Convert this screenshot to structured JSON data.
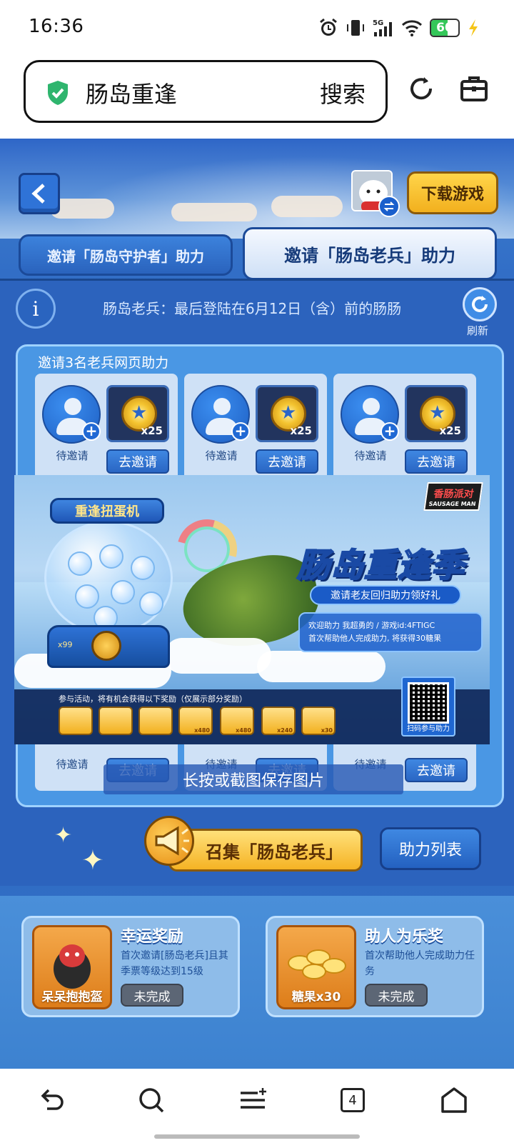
{
  "status_bar": {
    "time": "16:36",
    "battery_level": "60",
    "icons": [
      "alarm-icon",
      "vibrate-icon",
      "signal-5g-icon",
      "wifi-icon",
      "battery-icon",
      "charging-icon"
    ]
  },
  "browser": {
    "query": "肠岛重逢",
    "search_label": "搜索",
    "icons": [
      "shield-check-icon",
      "refresh-icon",
      "toolbox-icon"
    ]
  },
  "game": {
    "download_label": "下载游戏",
    "tabs": [
      {
        "label": "邀请「肠岛守护者」助力",
        "active": false
      },
      {
        "label": "邀请「肠岛老兵」助力",
        "active": true
      }
    ],
    "veteran_rule": "肠岛老兵：最后登陆在6月12日（含）前的肠肠",
    "refresh_label": "刷新",
    "invite_title": "邀请3名老兵网页助力",
    "invite_cards": [
      {
        "status": "待邀请",
        "reward_qty": "x25",
        "button": "去邀请"
      },
      {
        "status": "待邀请",
        "reward_qty": "x25",
        "button": "去邀请"
      },
      {
        "status": "待邀请",
        "reward_qty": "x25",
        "button": "去邀请"
      }
    ],
    "invite_cards_lower": [
      {
        "status": "待邀请",
        "button": "去邀请"
      },
      {
        "status": "待邀请",
        "button": "去邀请"
      },
      {
        "status": "待邀请",
        "button": "去邀请"
      }
    ],
    "gather_label": "召集「肠岛老兵」",
    "help_list_label": "助力列表",
    "awards": [
      {
        "title": "幸运奖励",
        "desc": "首次邀请[肠岛老兵]且其季票等级达到15级",
        "item": "呆呆抱抱盔",
        "status": "未完成"
      },
      {
        "title": "助人为乐奖",
        "desc": "首次帮助他人完成助力任务",
        "item": "糖果x30",
        "status": "未完成"
      }
    ]
  },
  "poster": {
    "machine_title": "重逢扭蛋机",
    "machine_counter": "x99",
    "logo_text": "香肠派对",
    "logo_sub": "SAUSAGE MAN",
    "season_title": "肠岛重逢季",
    "season_subtitle": "邀请老友回归助力领好礼",
    "welcome_line1": "欢迎助力 我超勇的 / 游戏id:4FTIGC",
    "welcome_line2": "首次帮助他人完成助力, 将获得30糖果",
    "rewards_caption": "参与活动，将有机会获得以下奖励（仅展示部分奖励）",
    "reward_counts": [
      "",
      "",
      "",
      "x480",
      "x480",
      "x240",
      "x30"
    ],
    "qr_label": "扫码参与助力",
    "save_hint": "长按或截图保存图片"
  },
  "bottom_nav": {
    "tabs_count": "4",
    "icons": [
      "back-icon",
      "search-icon",
      "menu-icon",
      "tabs-icon",
      "home-icon"
    ]
  }
}
